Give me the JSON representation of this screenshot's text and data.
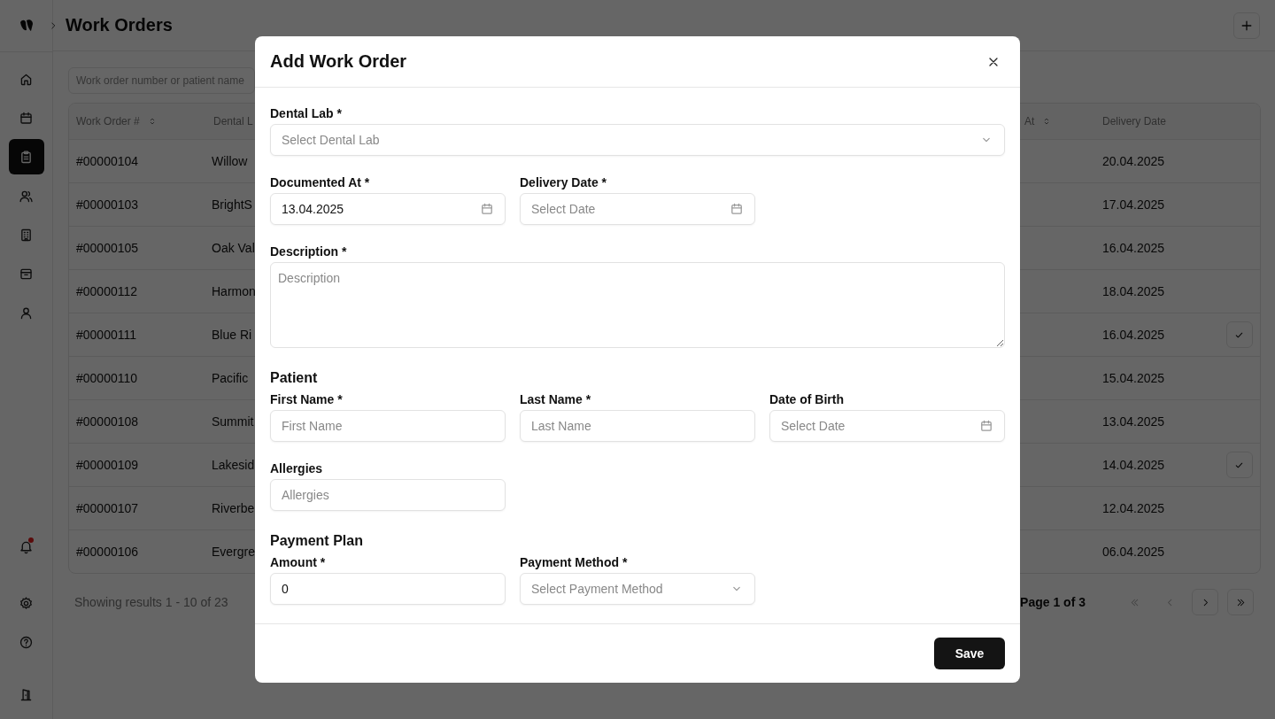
{
  "header": {
    "title": "Work Orders"
  },
  "sidebar": {
    "items": [
      {
        "kind": "home",
        "selected": false,
        "notification": false
      },
      {
        "kind": "calendar",
        "selected": false,
        "notification": false
      },
      {
        "kind": "clipboard",
        "selected": true,
        "notification": false
      },
      {
        "kind": "users",
        "selected": false,
        "notification": false
      },
      {
        "kind": "building",
        "selected": false,
        "notification": false
      },
      {
        "kind": "inbox",
        "selected": false,
        "notification": false
      },
      {
        "kind": "user",
        "selected": false,
        "notification": false
      }
    ],
    "bottom_items": [
      {
        "kind": "bell",
        "selected": false,
        "notification": true
      },
      {
        "kind": "gear",
        "selected": false,
        "notification": false
      },
      {
        "kind": "help",
        "selected": false,
        "notification": false
      },
      {
        "kind": "door",
        "selected": false,
        "notification": false
      }
    ]
  },
  "search": {
    "placeholder": "Work order number or patient name"
  },
  "table": {
    "columns": [
      {
        "label": "Work Order #",
        "sortable": true
      },
      {
        "label": "Dental L",
        "sortable": false
      },
      {
        "label": "At",
        "sortable": true
      },
      {
        "label": "Delivery Date",
        "sortable": false
      }
    ],
    "rows": [
      {
        "work_order": "#00000104",
        "dental_lab": "Willow",
        "delivery_date": "20.04.2025",
        "checked": false
      },
      {
        "work_order": "#00000103",
        "dental_lab": "BrightS",
        "delivery_date": "17.04.2025",
        "checked": false
      },
      {
        "work_order": "#00000105",
        "dental_lab": "Oak Val",
        "delivery_date": "16.04.2025",
        "checked": false
      },
      {
        "work_order": "#00000112",
        "dental_lab": "Harmon",
        "delivery_date": "18.04.2025",
        "checked": false
      },
      {
        "work_order": "#00000111",
        "dental_lab": "Blue Ri",
        "delivery_date": "16.04.2025",
        "checked": true
      },
      {
        "work_order": "#00000110",
        "dental_lab": "Pacific",
        "delivery_date": "15.04.2025",
        "checked": false
      },
      {
        "work_order": "#00000108",
        "dental_lab": "Summit",
        "delivery_date": "13.04.2025",
        "checked": false
      },
      {
        "work_order": "#00000109",
        "dental_lab": "Lakesid",
        "delivery_date": "14.04.2025",
        "checked": true
      },
      {
        "work_order": "#00000107",
        "dental_lab": "Riverbe",
        "delivery_date": "12.04.2025",
        "checked": false
      },
      {
        "work_order": "#00000106",
        "dental_lab": "Evergre",
        "delivery_date": "06.04.2025",
        "checked": false
      }
    ]
  },
  "pagination": {
    "summary": "Showing results 1 - 10 of 23",
    "page": "Page 1 of 3",
    "buttons": [
      {
        "kind": "first",
        "disabled": true
      },
      {
        "kind": "prev",
        "disabled": true
      },
      {
        "kind": "next",
        "disabled": false
      },
      {
        "kind": "last",
        "disabled": false
      }
    ]
  },
  "modal": {
    "title": "Add Work Order",
    "blocks": [
      {
        "kind": "fields",
        "fields": [
          {
            "kind": "select",
            "label": "Dental Lab *",
            "placeholder": "Select Dental Lab",
            "wide": true
          }
        ]
      },
      {
        "kind": "fields",
        "fields": [
          {
            "kind": "date",
            "label": "Documented At *",
            "value": "13.04.2025",
            "wide": false
          },
          {
            "kind": "date",
            "label": "Delivery Date *",
            "placeholder": "Select Date",
            "wide": false
          }
        ]
      },
      {
        "kind": "fields",
        "fields": [
          {
            "kind": "textarea",
            "label": "Description *",
            "placeholder": "Description",
            "wide": true
          }
        ]
      },
      {
        "kind": "heading",
        "text": "Patient"
      },
      {
        "kind": "fields",
        "fields": [
          {
            "kind": "text",
            "label": "First Name *",
            "placeholder": "First Name",
            "wide": false
          },
          {
            "kind": "text",
            "label": "Last Name *",
            "placeholder": "Last Name",
            "wide": false
          },
          {
            "kind": "date",
            "label": "Date of Birth",
            "placeholder": "Select Date",
            "wide": false
          }
        ]
      },
      {
        "kind": "fields",
        "fields": [
          {
            "kind": "text",
            "label": "Allergies",
            "placeholder": "Allergies",
            "wide": false
          }
        ]
      },
      {
        "kind": "heading",
        "text": "Payment Plan"
      },
      {
        "kind": "fields",
        "fields": [
          {
            "kind": "text",
            "label": "Amount *",
            "value": "0",
            "wide": false
          },
          {
            "kind": "select",
            "label": "Payment Method *",
            "placeholder": "Select Payment Method",
            "wide": false
          }
        ]
      }
    ],
    "save": "Save"
  }
}
